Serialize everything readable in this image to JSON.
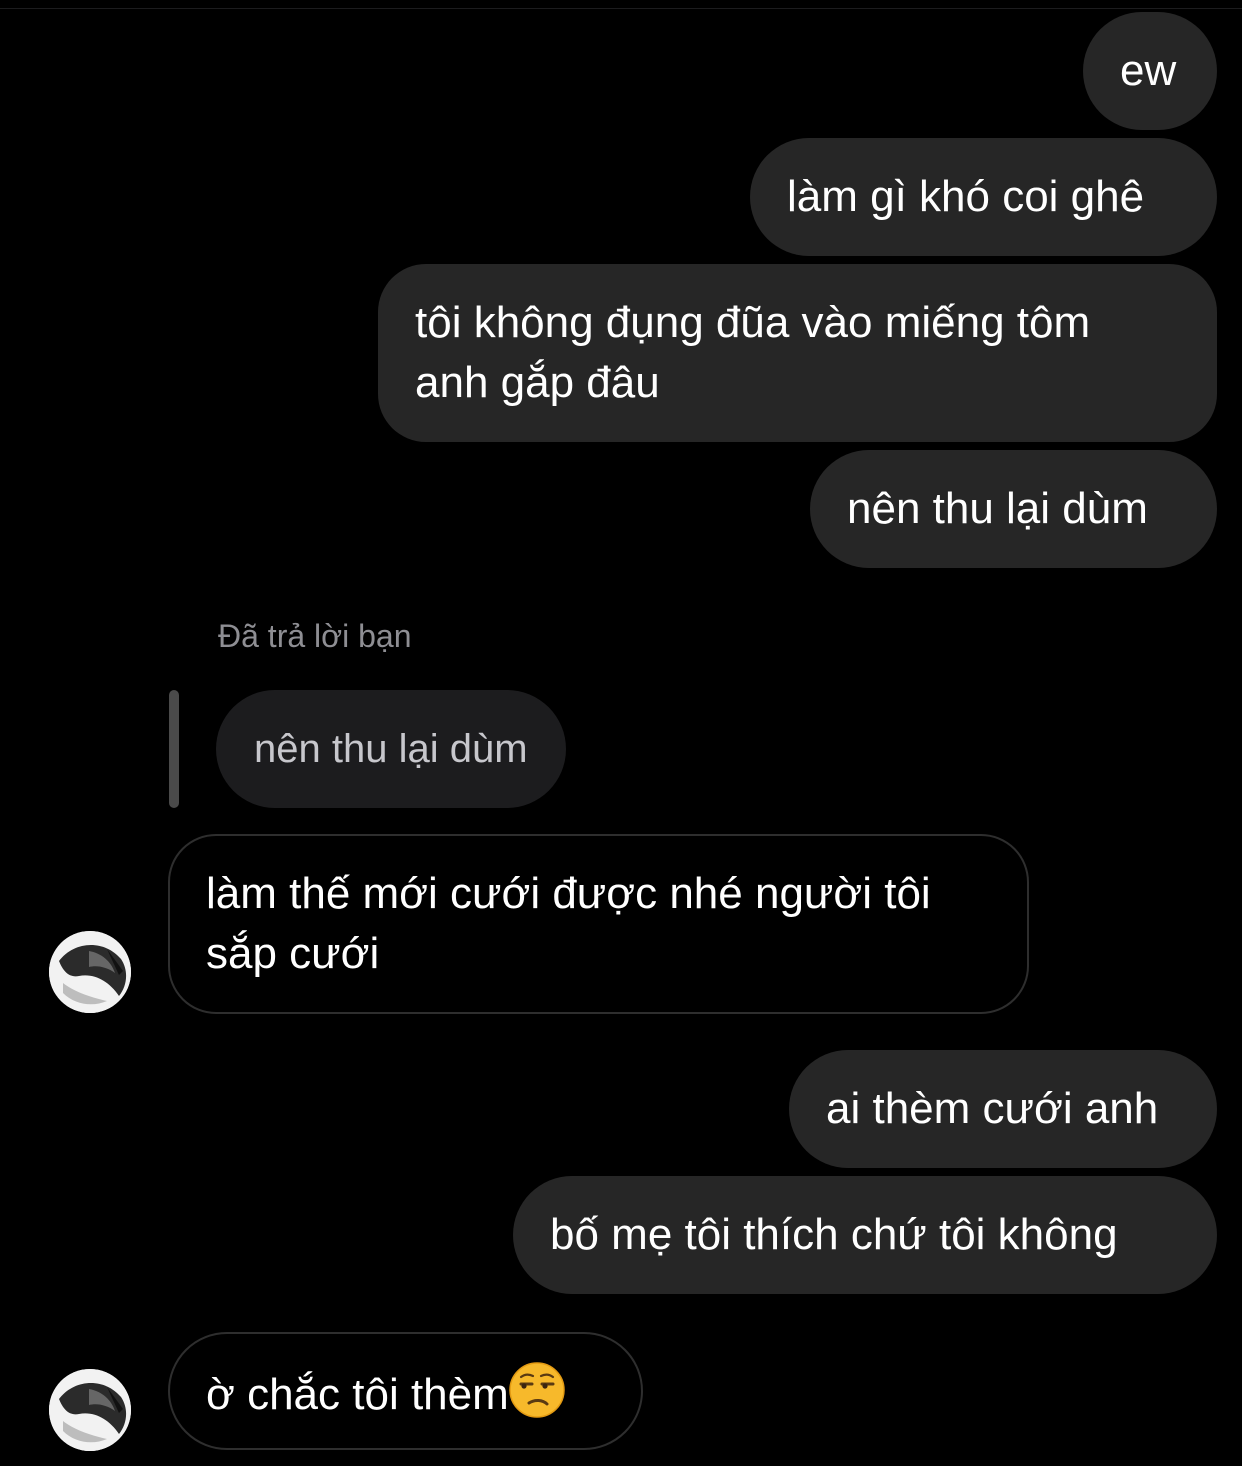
{
  "messages": {
    "m1": "ew",
    "m2": "làm gì khó coi ghê",
    "m3_line1": "tôi không đụng đũa vào miếng tôm",
    "m3_line2": "anh gắp đâu",
    "m4": "nên thu lại dùm",
    "reply_label": "Đã trả lời bạn",
    "quoted_text": "nên thu lại dùm",
    "m5_line1": "làm thế mới cưới được nhé người tôi",
    "m5_line2": "sắp cưới",
    "m6": "ai thèm cưới anh",
    "m7": "bố mẹ tôi thích chứ tôi không",
    "m8": "ờ chắc tôi thèm"
  },
  "icons": {
    "avatar": "contact-avatar",
    "emoji": "unamused-face-emoji"
  },
  "colors": {
    "background": "#000000",
    "outgoing_bubble": "#262626",
    "incoming_border": "#2e2e2e",
    "quoted_bubble": "#1c1c1e",
    "secondary_text": "#8e8e93",
    "emoji_face": "#f7b92b"
  }
}
